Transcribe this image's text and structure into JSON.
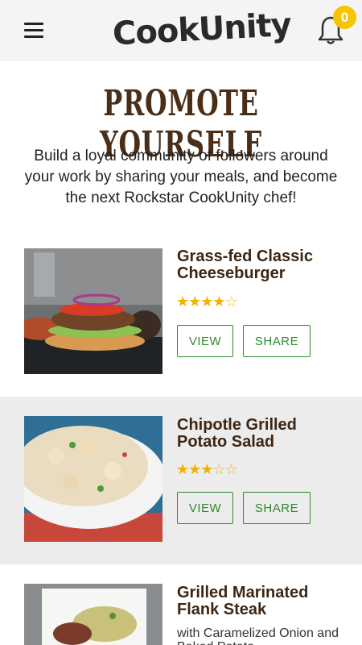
{
  "header": {
    "logo_text": "CookUnity",
    "notification_count": "0"
  },
  "promo": {
    "title": "PROMOTE YOURSELF",
    "text": "Build a loyal community of followers around your work by sharing your meals, and become the next Rockstar CookUnity chef!"
  },
  "meals": [
    {
      "title": "Grass-fed Classic Cheeseburger",
      "rating": 4,
      "max_rating": 5,
      "view_label": "VIEW",
      "share_label": "SHARE"
    },
    {
      "title": "Chipotle Grilled Potato Salad",
      "rating": 3,
      "max_rating": 5,
      "view_label": "VIEW",
      "share_label": "SHARE"
    },
    {
      "title": "Grilled Marinated Flank Steak",
      "subtitle": "with Caramelized Onion and Baked Potato"
    }
  ],
  "colors": {
    "brand_brown": "#4a2e17",
    "accent_green": "#2e8a2e",
    "badge_yellow": "#f5c500",
    "star_gold": "#f0b100"
  }
}
